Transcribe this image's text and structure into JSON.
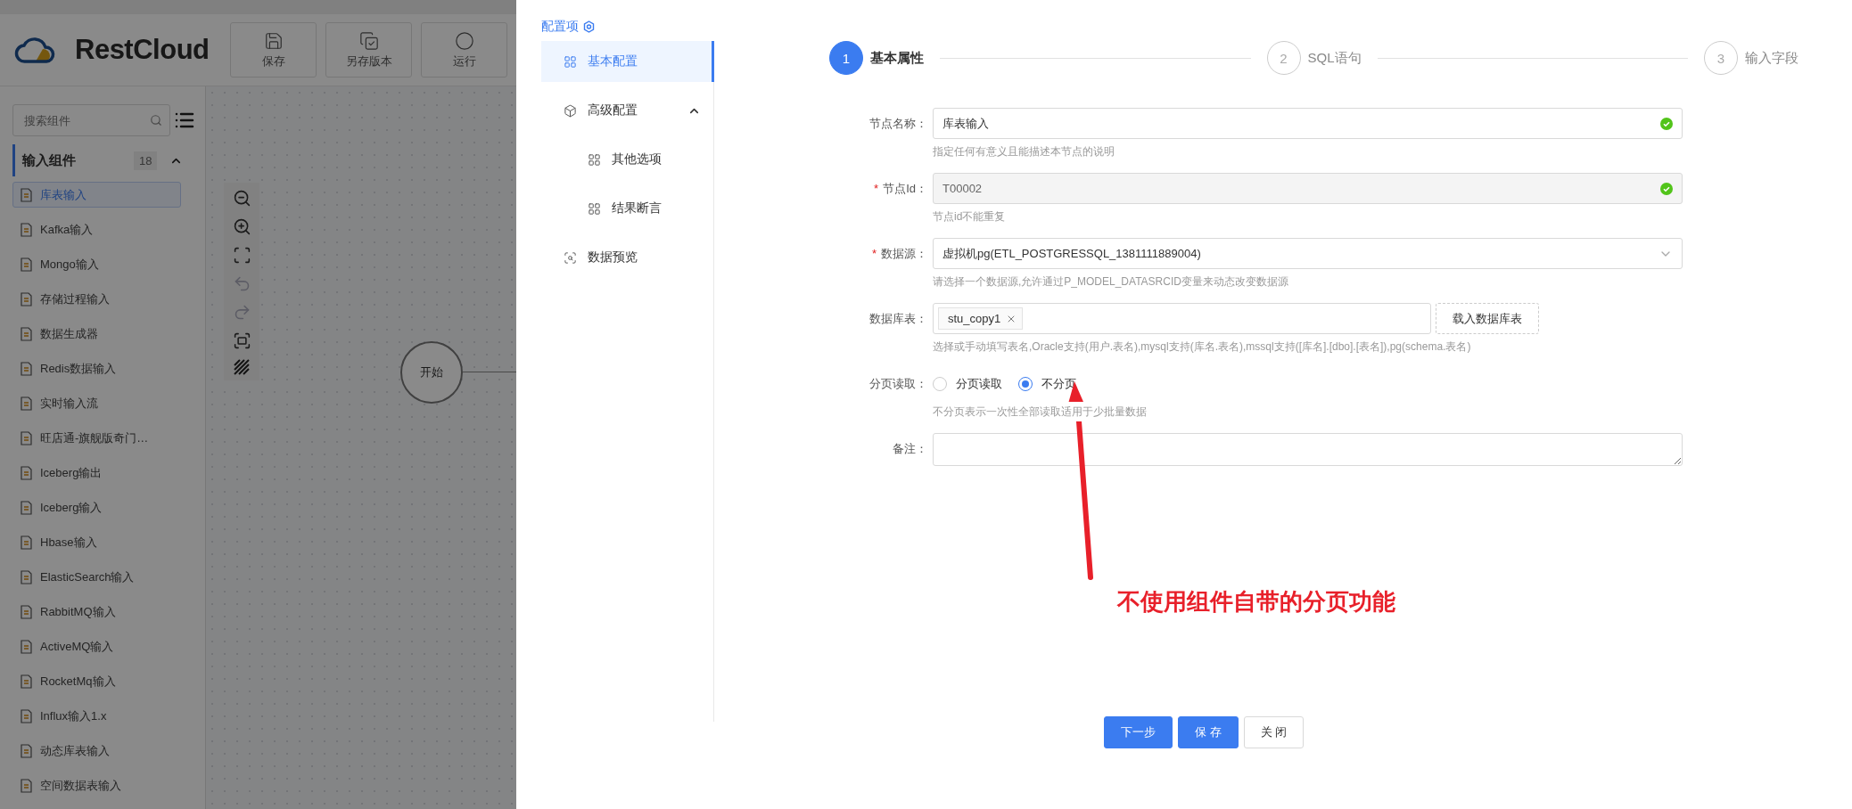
{
  "app": {
    "logo": "RestCloud",
    "toolbar": [
      {
        "label": "保存",
        "kind": "save"
      },
      {
        "label": "另存版本",
        "kind": "version"
      },
      {
        "label": "运行",
        "kind": "run"
      }
    ]
  },
  "sidebar": {
    "search": {
      "placeholder": "搜索组件"
    },
    "section": {
      "title": "输入组件",
      "count": "18",
      "expanded": true
    },
    "items": [
      {
        "label": "库表输入",
        "selected": true
      },
      {
        "label": "Kafka输入",
        "selected": false
      },
      {
        "label": "Mongo输入",
        "selected": false
      },
      {
        "label": "存储过程输入",
        "selected": false
      },
      {
        "label": "数据生成器",
        "selected": false
      },
      {
        "label": "Redis数据输入",
        "selected": false
      },
      {
        "label": "实时输入流",
        "selected": false
      },
      {
        "label": "旺店通-旗舰版奇门…",
        "selected": false
      },
      {
        "label": "Iceberg输出",
        "selected": false
      },
      {
        "label": "Iceberg输入",
        "selected": false
      },
      {
        "label": "Hbase输入",
        "selected": false
      },
      {
        "label": "ElasticSearch输入",
        "selected": false
      },
      {
        "label": "RabbitMQ输入",
        "selected": false
      },
      {
        "label": "ActiveMQ输入",
        "selected": false
      },
      {
        "label": "RocketMq输入",
        "selected": false
      },
      {
        "label": "Influx输入1.x",
        "selected": false
      },
      {
        "label": "动态库表输入",
        "selected": false
      },
      {
        "label": "空间数据表输入",
        "selected": false
      }
    ]
  },
  "canvas": {
    "nodes": [
      {
        "label": "开始"
      }
    ]
  },
  "config_nav": {
    "title": "配置项",
    "items": [
      {
        "label": "基本配置",
        "selected": true
      },
      {
        "label": "高级配置",
        "selected": false,
        "expanded": true,
        "children": [
          {
            "label": "其他选项",
            "selected": false
          },
          {
            "label": "结果断言",
            "selected": false
          }
        ]
      },
      {
        "label": "数据预览",
        "selected": false
      }
    ]
  },
  "steps": [
    {
      "number": "1",
      "label": "基本属性",
      "active": true
    },
    {
      "number": "2",
      "label": "SQL语句",
      "active": false
    },
    {
      "number": "3",
      "label": "输入字段",
      "active": false
    }
  ],
  "form": {
    "fields": [
      {
        "kind": "text",
        "label": "节点名称：",
        "value": "库表输入",
        "valid": true,
        "disabled": false,
        "hint": "指定任何有意义且能描述本节点的说明"
      },
      {
        "kind": "text",
        "label": "节点Id：",
        "mark": "*",
        "value": "T00002",
        "valid": true,
        "disabled": true,
        "hint": "节点id不能重复"
      },
      {
        "kind": "select",
        "label": "数据源：",
        "mark": "*",
        "value": "虚拟机pg(ETL_POSTGRESSQL_1381111889004)",
        "hint": "请选择一个数据源,允许通过P_MODEL_DATASRCID变量来动态改变数据源"
      },
      {
        "kind": "tags",
        "label": "数据库表：",
        "tags": [
          "stu_copy1"
        ],
        "action": "载入数据库表",
        "hint": "选择或手动填写表名,Oracle支持(用户.表名),mysql支持(库名.表名),mssql支持([库名].[dbo].[表名]),pg(schema.表名)"
      },
      {
        "kind": "radio",
        "label": "分页读取：",
        "options": [
          {
            "label": "分页读取",
            "selected": false
          },
          {
            "label": "不分页",
            "selected": true
          }
        ],
        "hint": "不分页表示一次性全部读取适用于少批量数据"
      },
      {
        "kind": "textarea",
        "label": "备注："
      }
    ]
  },
  "buttons": [
    {
      "label": "下一步",
      "kind": "primary"
    },
    {
      "label": "保 存",
      "kind": "primary"
    },
    {
      "label": "关 闭",
      "kind": "default"
    }
  ],
  "annotation": {
    "text": "不使用组件自带的分页功能"
  }
}
